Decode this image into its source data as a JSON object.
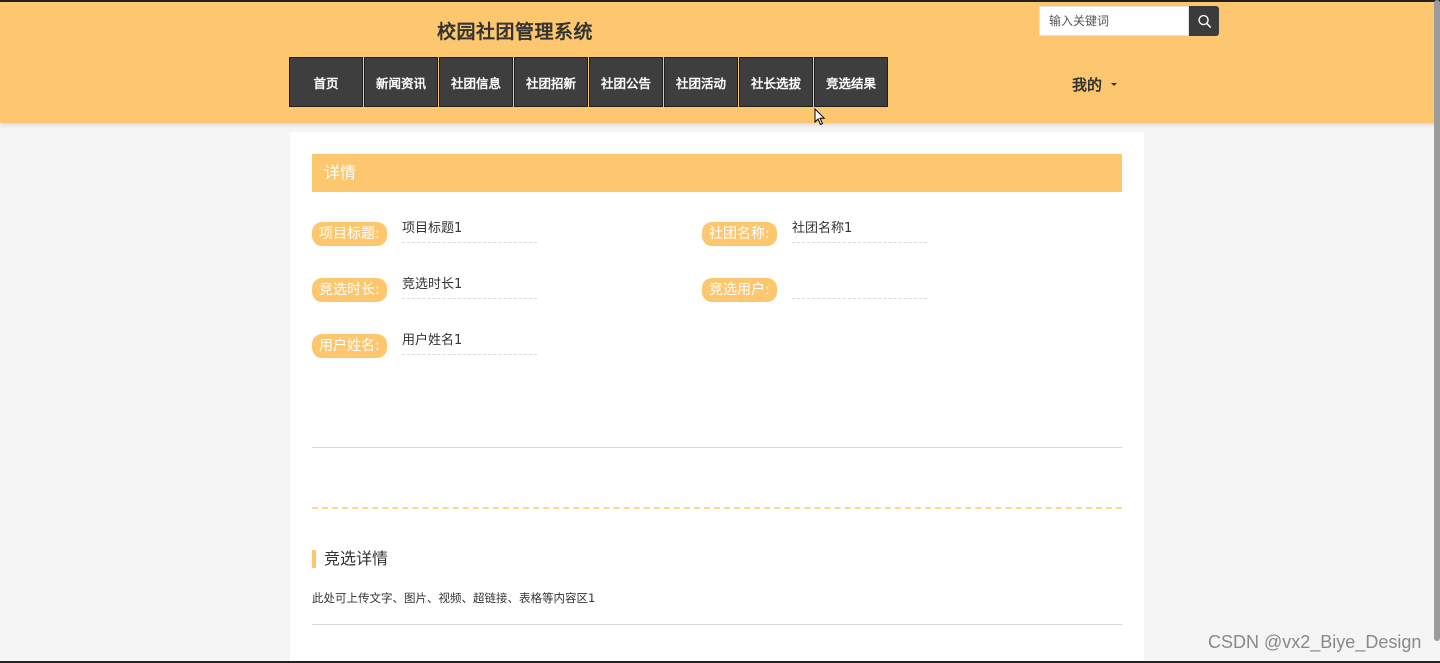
{
  "header": {
    "site_title": "校园社团管理系统",
    "search": {
      "placeholder": "输入关键词",
      "icon": "search-icon"
    },
    "nav": [
      {
        "label": "首页"
      },
      {
        "label": "新闻资讯"
      },
      {
        "label": "社团信息"
      },
      {
        "label": "社团招新"
      },
      {
        "label": "社团公告"
      },
      {
        "label": "社团活动"
      },
      {
        "label": "社长选拔"
      },
      {
        "label": "竞选结果"
      }
    ],
    "user_menu": "我的"
  },
  "detail": {
    "section_title": "详情",
    "fields": [
      {
        "label": "项目标题:",
        "value": "项目标题1"
      },
      {
        "label": "社团名称:",
        "value": "社团名称1"
      },
      {
        "label": "竞选时长:",
        "value": "竞选时长1"
      },
      {
        "label": "竞选用户:",
        "value": ""
      },
      {
        "label": "用户姓名:",
        "value": "用户姓名1"
      }
    ],
    "content_title": "竞选详情",
    "content_text": "此处可上传文字、图片、视频、超链接、表格等内容区1"
  },
  "watermark": "CSDN @vx2_Biye_Design",
  "colors": {
    "accent": "#fdc76f",
    "nav_bg": "#3e3e3e",
    "page_bg": "#f5f5f5"
  }
}
